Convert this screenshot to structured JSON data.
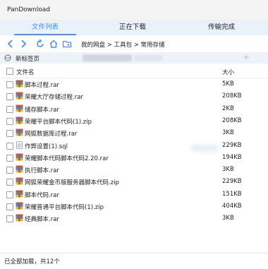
{
  "window": {
    "title": "PanDownload"
  },
  "tabs": [
    {
      "label": "文件列表",
      "active": true
    },
    {
      "label": "正在下载",
      "active": false
    },
    {
      "label": "传输完成",
      "active": false
    }
  ],
  "toolbar": {
    "breadcrumb": "我的网盘 > 工具包 > 常用存储"
  },
  "address": {
    "newtab_label": "新标签页"
  },
  "list": {
    "header_name": "文件名",
    "header_size": "大小",
    "rows": [
      {
        "name": "脚本过程.rar",
        "size": "5KB",
        "type": "rar"
      },
      {
        "name": "荣耀大厅存储过程.rar",
        "size": "208KB",
        "type": "rar"
      },
      {
        "name": "储存脚本.rar",
        "size": "2KB",
        "type": "rar"
      },
      {
        "name": "荣耀平台脚本代码(1).zip",
        "size": "208KB",
        "type": "zip"
      },
      {
        "name": "网狐数据库过程.rar",
        "size": "3KB",
        "type": "rar"
      },
      {
        "name": "作弊设置(1).sql",
        "size": "229KB",
        "type": "sql"
      },
      {
        "name": "荣耀脚本代码脚本代码2.20.rar",
        "size": "194KB",
        "type": "rar"
      },
      {
        "name": "执行脚本.rar",
        "size": "3KB",
        "type": "rar"
      },
      {
        "name": "网狐荣耀金币版服务器脚本代码.zip",
        "size": "229KB",
        "type": "zip"
      },
      {
        "name": "脚本代码.rar",
        "size": "151KB",
        "type": "rar"
      },
      {
        "name": "荣耀普通平台脚本代码(1).zip",
        "size": "404KB",
        "type": "zip"
      },
      {
        "name": "经典脚本.rar",
        "size": "3KB",
        "type": "rar"
      }
    ]
  },
  "status": {
    "text": "已全部加载，共12个"
  },
  "colors": {
    "accent": "#4d8fe3",
    "tabbar": "#e9f1fb",
    "addrbar": "#eef3fa"
  }
}
